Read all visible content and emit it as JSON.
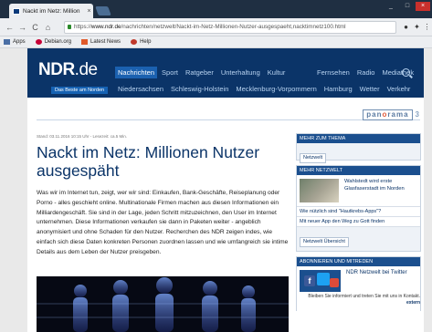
{
  "browser": {
    "tab_title": "Nackt im Netz: Million",
    "tab_close": "×",
    "window_controls": [
      "_",
      "□",
      "×"
    ],
    "url_host": "www.ndr.de",
    "url_path": "/nachrichten/netzwelt/Nackt-im-Netz-Millionen-Nutzer-ausgespaeht,nacktimnetz100.html",
    "url_prefix": "https://",
    "nav_back": "←",
    "nav_forward": "→",
    "nav_reload": "C",
    "nav_home": "⌂",
    "bookmarks": [
      {
        "label": "Apps",
        "color": "#4a6fa5"
      },
      {
        "label": "Debian.org",
        "color": "#c70036"
      },
      {
        "label": "Latest News",
        "color": "#e05a2a"
      },
      {
        "label": "Help",
        "color": "#c0392b"
      }
    ]
  },
  "site": {
    "logo": "NDR",
    "logo_suffix": ".de",
    "logo_tagline": "Das Beste am Norden",
    "nav_primary": [
      "Nachrichten",
      "Sport",
      "Ratgeber",
      "Unterhaltung",
      "Kultur"
    ],
    "nav_primary_right": [
      "Fernsehen",
      "Radio",
      "Mediathek"
    ],
    "nav_secondary": [
      "Niedersachsen",
      "Schleswig-Holstein",
      "Mecklenburg-Vorpommern",
      "Hamburg",
      "Wetter",
      "Verkehr"
    ],
    "panorama_label": "pan",
    "panorama_o": "o",
    "panorama_rest": "rama",
    "panorama_number": "3"
  },
  "article": {
    "meta": "Stand: 03.11.2016 10:15 Uhr - Lesezeit: ca.5 Min.",
    "headline": "Nackt im Netz: Millionen Nutzer ausgespäht",
    "lead": "Was wir im Internet tun, zeigt, wer wir sind: Einkaufen, Bank-Geschäfte, Reiseplanung oder Porno - alles geschieht online. Multinationale Firmen machen aus diesen Informationen ein Milliardengeschäft. Sie sind in der Lage, jeden Schritt mitzuzeichnen, den User im Internet unternehmen. Diese Informationen verkaufen sie dann in Paketen weiter - angeblich anonymisiert und ohne Schaden für den Nutzer. Recherchen des NDR zeigen indes, wie einfach sich diese Daten konkreten Personen zuordnen lassen und wie umfangreich sie intime Details aus dem Leben der Nutzer preisgeben."
  },
  "sidebar": {
    "topic_head": "MEHR ZUM THEMA",
    "topic_button": "Netzwelt",
    "netzwelt_head": "MEHR NETZWELT",
    "feature_title": "Wahlstedt wird erste Glasfaserstadt im Norden",
    "links": [
      "Wie nützlich sind \"Hautkrebs-Apps\"?",
      "Mit neuer App den Weg zu Gott finden"
    ],
    "overview_button": "Netzwelt Übersicht",
    "social_head": "ABONNIEREN UND MITREDEN",
    "twitter_title": "NDR Netzwelt bei Twitter",
    "twitter_text": "Bleiben Sie informiert und treten Sie mit uns in Kontakt.",
    "twitter_link": "extern"
  },
  "colors": {
    "ndr_blue": "#0b3468",
    "nav_active": "#1b61b0",
    "link_blue": "#0b3468"
  }
}
